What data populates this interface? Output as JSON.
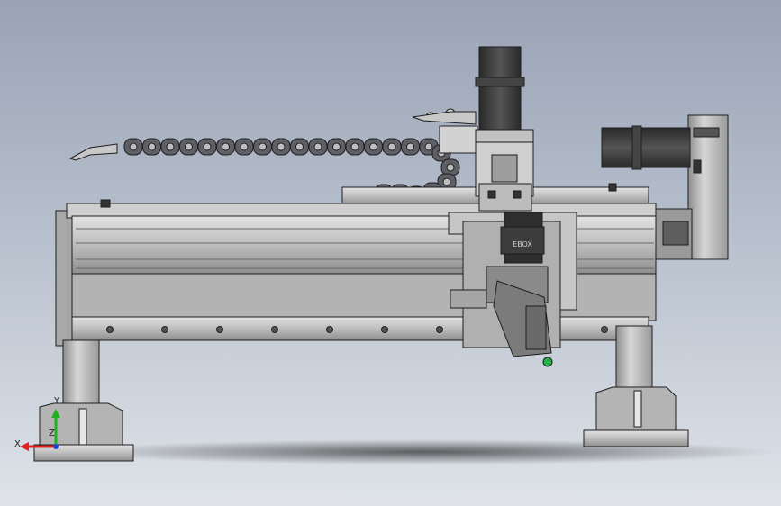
{
  "view": {
    "background_top": "#9aa3b5",
    "background_bottom": "#dfe3e9"
  },
  "model": {
    "steel": "#b9b9b9",
    "steel_light": "#d8d8d8",
    "steel_dark": "#7d7d7d",
    "motor_dark": "#3a3a3a",
    "chain": "#5f6066",
    "outline": "#1e1e1e",
    "head_label": "EBOX",
    "nozzle_color": "#22b14c"
  },
  "triad": {
    "x_label": "X",
    "y_label": "Y",
    "z_label": "Z",
    "x_color": "#e02020",
    "y_color": "#20b020",
    "z_color": "#2040e0"
  }
}
